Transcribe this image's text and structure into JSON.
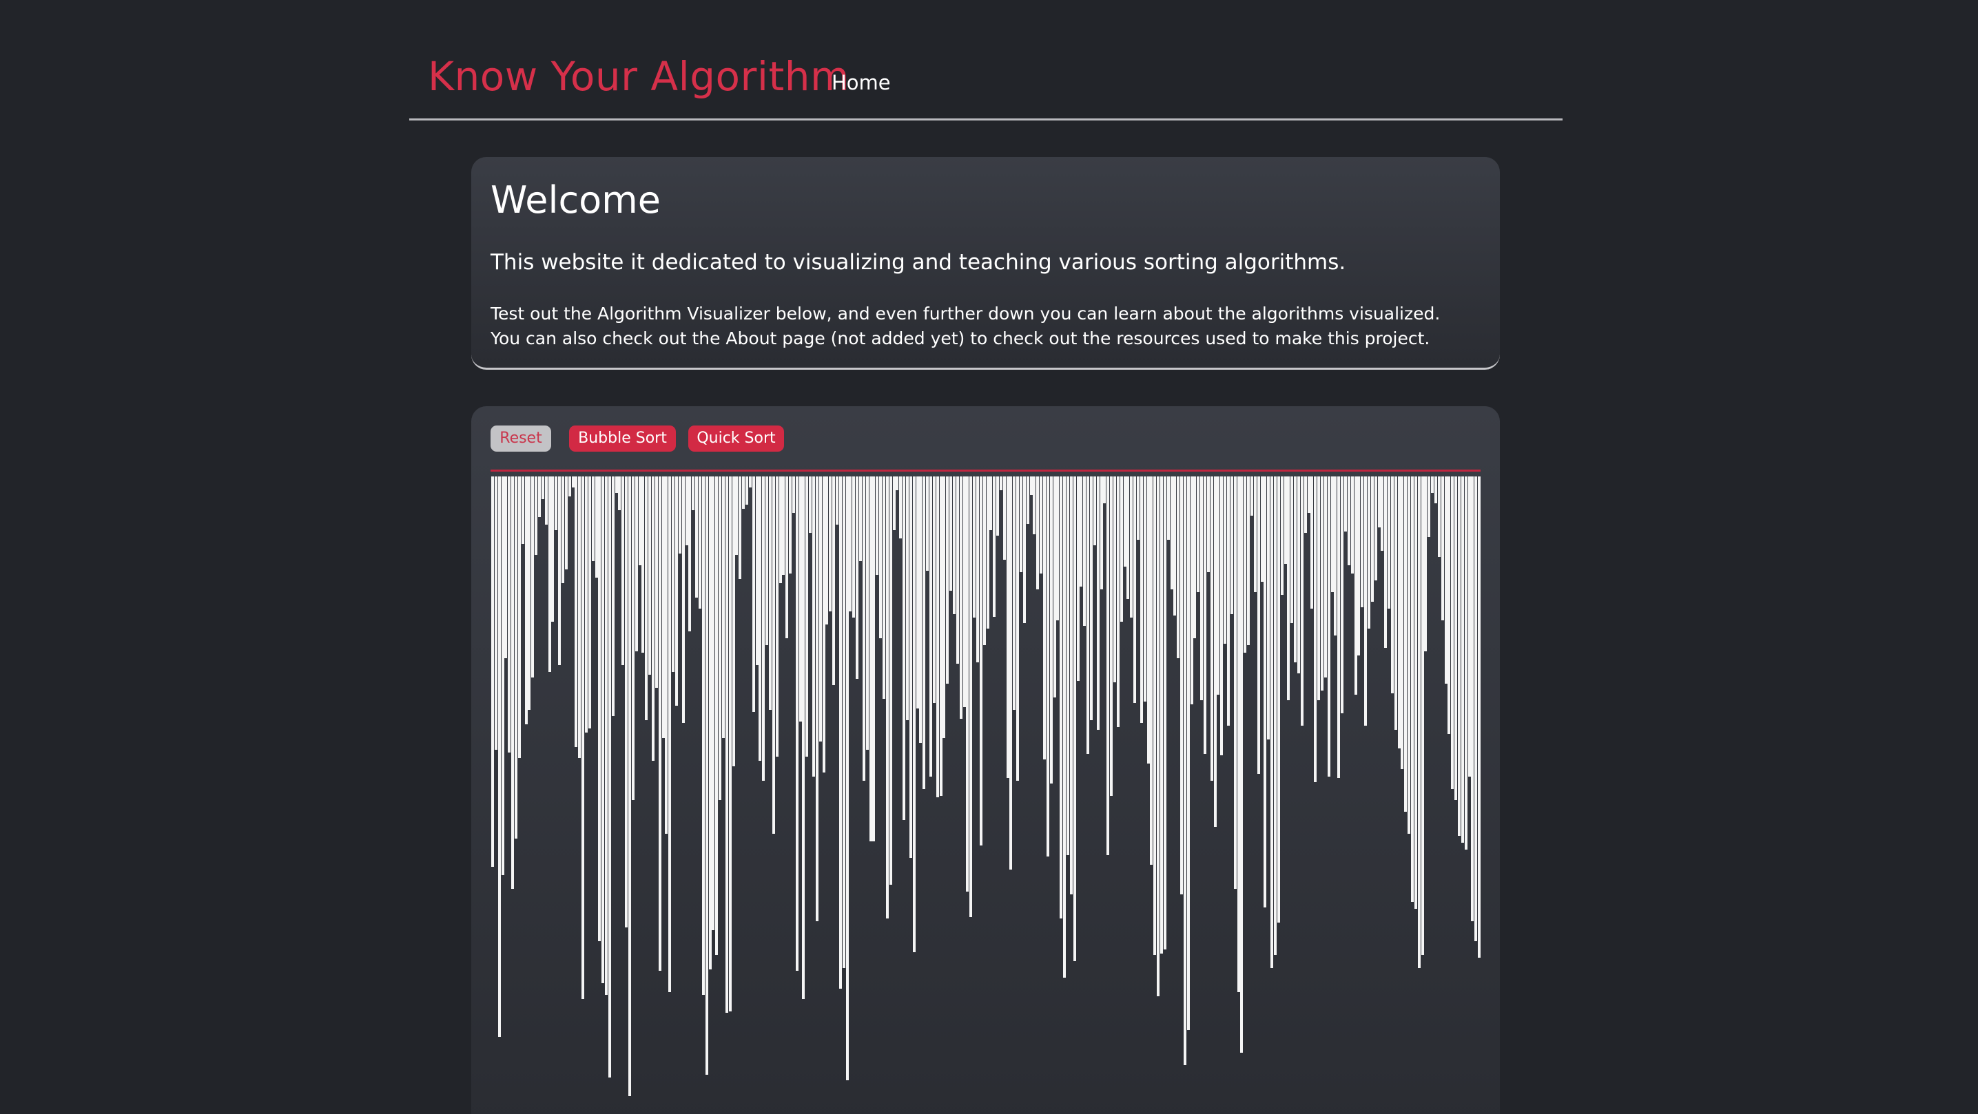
{
  "header": {
    "brand": "Know Your Algorithm",
    "nav": [
      {
        "label": "Home"
      }
    ]
  },
  "welcome": {
    "title": "Welcome",
    "lead": "This website it dedicated to visualizing and teaching various sorting algorithms.",
    "body_line1": "Test out the Algorithm Visualizer below, and even further down you can learn about the algorithms visualized.",
    "body_line2": "You can also check out the About page (not added yet) to check out the resources used to make this project."
  },
  "visualizer": {
    "buttons": {
      "reset": "Reset",
      "bubble": "Bubble Sort",
      "quick": "Quick Sort"
    },
    "values": [
      580,
      406,
      832,
      592,
      270,
      410,
      612,
      538,
      418,
      100,
      368,
      346,
      298,
      116,
      60,
      34,
      72,
      290,
      216,
      80,
      280,
      158,
      138,
      30,
      16,
      402,
      418,
      776,
      380,
      374,
      126,
      150,
      690,
      752,
      770,
      892,
      356,
      24,
      50,
      280,
      670,
      920,
      480,
      260,
      132,
      262,
      362,
      294,
      422,
      314,
      734,
      388,
      530,
      766,
      290,
      340,
      114,
      366,
      102,
      230,
      50,
      180,
      196,
      770,
      888,
      732,
      674,
      710,
      480,
      388,
      796,
      794,
      430,
      116,
      152,
      48,
      42,
      16,
      350,
      280,
      422,
      452,
      250,
      346,
      530,
      416,
      158,
      146,
      240,
      144,
      54,
      734,
      364,
      776,
      416,
      84,
      446,
      660,
      394,
      440,
      220,
      200,
      310,
      72,
      760,
      730,
      896,
      200,
      210,
      300,
      126,
      452,
      406,
      542,
      542,
      146,
      240,
      330,
      656,
      606,
      80,
      20,
      92,
      510,
      362,
      566,
      706,
      344,
      396,
      464,
      140,
      446,
      336,
      476,
      474,
      388,
      308,
      170,
      204,
      278,
      360,
      342,
      616,
      654,
      210,
      276,
      548,
      250,
      226,
      80,
      208,
      88,
      20,
      124,
      448,
      584,
      346,
      452,
      142,
      218,
      70,
      28,
      86,
      168,
      144,
      420,
      564,
      456,
      328,
      214,
      656,
      744,
      562,
      620,
      720,
      304,
      164,
      222,
      412,
      362,
      102,
      376,
      168,
      40,
      562,
      474,
      306,
      372,
      216,
      134,
      182,
      210,
      336,
      94,
      366,
      334,
      426,
      576,
      710,
      772,
      708,
      702,
      94,
      168,
      206,
      270,
      620,
      874,
      822,
      338,
      240,
      172,
      332,
      412,
      142,
      452,
      520,
      324,
      414,
      248,
      370,
      204,
      612,
      766,
      856,
      262,
      250,
      58,
      172,
      442,
      156,
      640,
      390,
      730,
      710,
      662,
      176,
      130,
      332,
      218,
      276,
      292,
      370,
      84,
      54,
      196,
      454,
      332,
      318,
      298,
      446,
      172,
      236,
      448,
      352,
      82,
      132,
      144,
      324,
      266,
      194,
      370,
      226,
      186,
      154,
      76,
      110,
      254,
      196,
      322,
      376,
      404,
      434,
      498,
      530,
      632,
      642,
      730,
      710,
      260,
      90,
      24,
      40,
      120,
      214,
      308,
      382,
      464,
      480,
      534,
      544,
      554,
      446,
      660,
      690,
      714
    ],
    "max_value": 920
  }
}
